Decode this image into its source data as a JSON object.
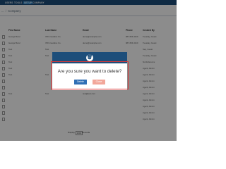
{
  "nav": {
    "items": [
      "USERS",
      "TOOLS",
      "SETUP",
      "COMPANY"
    ],
    "active": "SETUP"
  },
  "breadcrumb": {
    "parent": "...",
    "current": "Company"
  },
  "table": {
    "columns": [
      "First Name",
      "Last Name",
      "Email",
      "Phone",
      "Created By"
    ],
    "rows": [
      [
        "George Burel",
        "VB Innovative Co.",
        "demo@example.com",
        "987-654-3210",
        "Tuesday, Guest"
      ],
      [
        "George Burel",
        "VB Innovative Co.",
        "demo@example.com",
        "987-654-3210",
        "Tuesday, Guest"
      ],
      [
        "Test",
        "Test",
        "",
        "",
        "Sep, Guest"
      ],
      [
        "Test",
        "Test",
        "",
        "",
        "Tuesday, Guest"
      ],
      [
        "Test",
        "",
        "",
        "",
        "No Reference"
      ],
      [
        "Test",
        "",
        "",
        "",
        "Agent, Admin"
      ],
      [
        "Test",
        "Test",
        "",
        "",
        "Agent, Admin"
      ],
      [
        "",
        "",
        "",
        "",
        "Agent, Admin"
      ],
      [
        "",
        "",
        "",
        "",
        "Agent, Admin"
      ],
      [
        "Test",
        "Test",
        "test@test.com",
        "",
        "Agent, Admin"
      ],
      [
        "",
        "",
        "",
        "",
        "Agent, Admin"
      ],
      [
        "",
        "",
        "",
        "",
        "Agent, Admin"
      ],
      [
        "",
        "",
        "",
        "",
        "Agent, Admin"
      ],
      [
        "",
        "",
        "",
        "",
        "Agent, Admin"
      ]
    ]
  },
  "pager": {
    "text": "Display",
    "count": "1000",
    "suffix": "Records"
  },
  "modal": {
    "icon": "trash-icon",
    "icon_glyph": "🗑",
    "message": "Are you sure you want to delete?",
    "delete_label": "Delete",
    "close_label": "Close"
  },
  "colors": {
    "header": "#1d4e7a",
    "accent": "#2f86c9",
    "delete": "#2f6fb5",
    "close": "#f2a79a",
    "highlight": "#d9383a"
  }
}
